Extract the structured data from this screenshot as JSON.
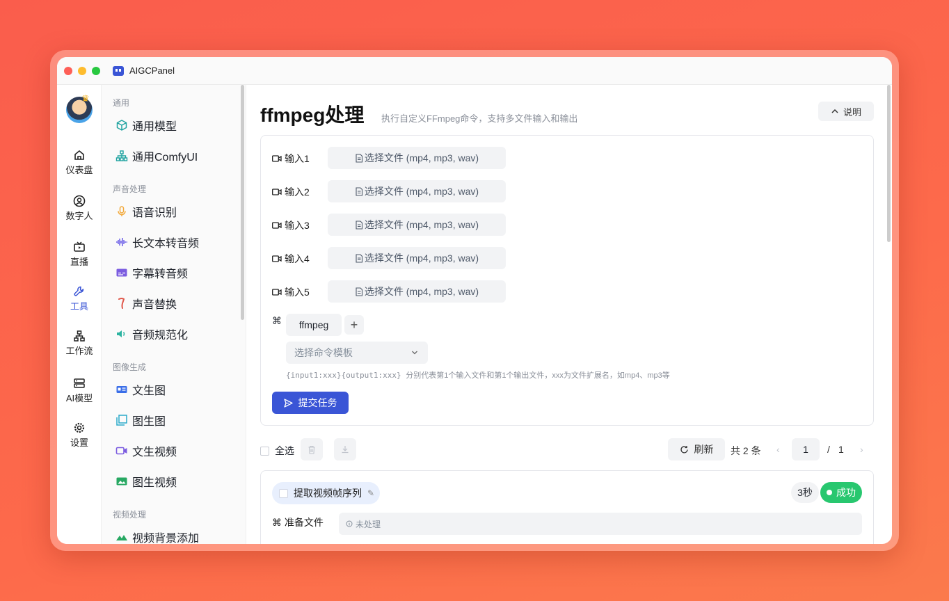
{
  "window": {
    "title": "AIGCPanel",
    "traffic_lights": [
      "#fe5f57",
      "#febc2e",
      "#28c840"
    ]
  },
  "rail": {
    "items": [
      {
        "label": "仪表盘",
        "icon": "home-icon"
      },
      {
        "label": "数字人",
        "icon": "user-circle-icon"
      },
      {
        "label": "直播",
        "icon": "tv-icon"
      },
      {
        "label": "工具",
        "icon": "wrench-icon",
        "active": true
      },
      {
        "label": "工作流",
        "icon": "workflow-icon"
      },
      {
        "label": "AI模型",
        "icon": "server-icon"
      },
      {
        "label": "设置",
        "icon": "gear-icon"
      }
    ]
  },
  "sidebar": {
    "sections": [
      "通用",
      "声音处理",
      "图像生成",
      "视频处理"
    ],
    "items": [
      {
        "label": "通用模型",
        "icon": "cube-icon",
        "color": "#1fa3a0"
      },
      {
        "label": "通用ComfyUI",
        "icon": "sitemap-icon",
        "color": "#1fa3a0"
      },
      {
        "label": "语音识别",
        "icon": "microphone-icon",
        "color": "#f2a93b"
      },
      {
        "label": "长文本转音频",
        "icon": "waveform-icon",
        "color": "#6b5ce7"
      },
      {
        "label": "字幕转音频",
        "icon": "subtitle-icon",
        "color": "#7b5ce0"
      },
      {
        "label": "声音替换",
        "icon": "vocal-icon",
        "color": "#e0584b"
      },
      {
        "label": "音频规范化",
        "icon": "speaker-icon",
        "color": "#2bb3a0"
      },
      {
        "label": "文生图",
        "icon": "text-image-icon",
        "color": "#3a6ee8"
      },
      {
        "label": "图生图",
        "icon": "image-stack-icon",
        "color": "#2aa9c9"
      },
      {
        "label": "文生视频",
        "icon": "video-camera-icon",
        "color": "#7b5ce0"
      },
      {
        "label": "图生视频",
        "icon": "image-video-icon",
        "color": "#27a862"
      },
      {
        "label": "视频背景添加",
        "icon": "mountain-icon",
        "color": "#27a862"
      }
    ]
  },
  "main": {
    "title": "ffmpeg处理",
    "subtitle": "执行自定义FFmpeg命令，支持多文件输入和输出",
    "help_label": "说明",
    "inputs": [
      {
        "label": "输入1",
        "button": "选择文件 (mp4, mp3, wav)"
      },
      {
        "label": "输入2",
        "button": "选择文件 (mp4, mp3, wav)"
      },
      {
        "label": "输入3",
        "button": "选择文件 (mp4, mp3, wav)"
      },
      {
        "label": "输入4",
        "button": "选择文件 (mp4, mp3, wav)"
      },
      {
        "label": "输入5",
        "button": "选择文件 (mp4, mp3, wav)"
      }
    ],
    "cmd_symbol": "⌘",
    "command": "ffmpeg",
    "template_placeholder": "选择命令模板",
    "hint_code": "{input1:xxx}{output1:xxx}",
    "hint_text": "分别代表第1个输入文件和第1个输出文件，xxx为文件扩展名，如mp4、mp3等",
    "submit_label": "提交任务",
    "accent": "#3a55d6"
  },
  "list": {
    "select_all": "全选",
    "refresh": "刷新",
    "total": "共 2 条",
    "page": "1",
    "page_sep": "/",
    "page_total": "1"
  },
  "task": {
    "name": "提取视频帧序列",
    "duration": "3秒",
    "status": "成功",
    "status_color": "#28c76f",
    "step_label": "准备文件",
    "step_status": "未处理"
  }
}
